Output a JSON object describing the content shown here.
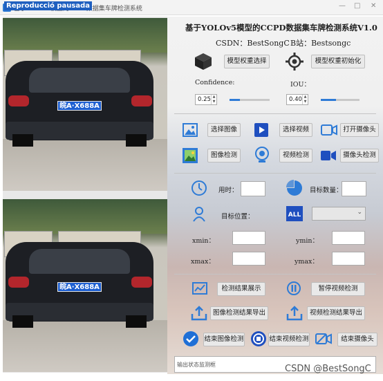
{
  "window": {
    "title": "基于YOLOv5模型的CCPD数据集车牌检测系统",
    "paused_badge": "Reproducció pausada",
    "controls": [
      "—",
      "□",
      "✕"
    ]
  },
  "images": [
    {
      "plate": "皖A·X688A"
    },
    {
      "plate": "皖A·X688A"
    }
  ],
  "header": {
    "title": "基于YOLOv5模型的CCPD数据集车牌检测系统V1.0",
    "csdn": "CSDN：BestSongC",
    "bilibili": "B站：Bestsongc"
  },
  "model": {
    "select_weights": "模型权重选择",
    "init_weights": "模型权重初始化",
    "confidence_label": "Confidence:",
    "confidence_value": "0.25",
    "confidence_fraction": 0.25,
    "iou_label": "IOU：",
    "iou_value": "0.40",
    "iou_fraction": 0.4
  },
  "actions": {
    "select_image": "选择图像",
    "select_video": "选择视频",
    "open_camera": "打开摄像头",
    "image_detect": "图像检测",
    "video_detect": "视频检测",
    "camera_detect": "摄像头检测"
  },
  "results": {
    "time_label": "用时：",
    "time_value": "",
    "count_label": "目标数量：",
    "count_value": "",
    "position_label": "目标位置：",
    "target_select_value": "",
    "xmin_label": "xmin：",
    "ymin_label": "ymin：",
    "xmax_label": "xmax：",
    "ymax_label": "ymax：",
    "all_badge": "ALL"
  },
  "bottom": {
    "show_results": "检测结果展示",
    "pause_video": "暂停视频检测",
    "export_image": "图像检测结果导出",
    "export_video": "视频检测结果导出",
    "end_image": "结束图像检测",
    "end_video": "结束视频检测",
    "end_camera": "结束摄像头"
  },
  "status": {
    "placeholder": "输出状态监测框"
  },
  "watermark": "CSDN @BestSongC",
  "colors": {
    "accent": "#2e7bd6",
    "plate_blue": "#1d5fd1"
  }
}
